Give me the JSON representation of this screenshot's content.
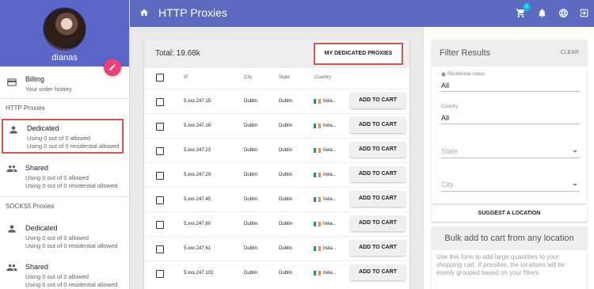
{
  "profile": {
    "username": "dianas"
  },
  "sidebar": {
    "billing": {
      "title": "Billing",
      "subtitle": "Your order history"
    },
    "http_section": "HTTP Proxies",
    "http_items": [
      {
        "title": "Dedicated",
        "line1": "Using 0 out of 0 allowed",
        "line2": "Using 0 out of 0 residential allowed"
      },
      {
        "title": "Shared",
        "line1": "Using 0 out of 0 allowed",
        "line2": "Using 0 out of 0 residential allowed"
      }
    ],
    "socks_section": "SOCKS5 Proxies",
    "socks_items": [
      {
        "title": "Dedicated",
        "line1": "Using 0 out of 0 allowed",
        "line2": "Using 0 out of 0 residential allowed"
      },
      {
        "title": "Shared",
        "line1": "Using 0 out of 0 allowed",
        "line2": "Using 0 out of 0 residential allowed"
      }
    ]
  },
  "topbar": {
    "title": "HTTP Proxies",
    "cart_count": "0"
  },
  "table": {
    "total": "Total: 19.68k",
    "dedicated_button": "MY DEDICATED PROXIES",
    "headers": {
      "ip": "IP",
      "city": "City",
      "state": "State",
      "country": "Country"
    },
    "add_label": "ADD TO CART",
    "rows": [
      {
        "ip": "5.xxx.247.15",
        "city": "Dublin",
        "state": "Dublin",
        "country": "Irela..."
      },
      {
        "ip": "5.xxx.247.18",
        "city": "Dublin",
        "state": "Dublin",
        "country": "Irela..."
      },
      {
        "ip": "5.xxx.247.23",
        "city": "Dublin",
        "state": "Dublin",
        "country": "Irela..."
      },
      {
        "ip": "5.xxx.247.29",
        "city": "Dublin",
        "state": "Dublin",
        "country": "Irela..."
      },
      {
        "ip": "5.xxx.247.45",
        "city": "Dublin",
        "state": "Dublin",
        "country": "Irela..."
      },
      {
        "ip": "5.xxx.247.60",
        "city": "Dublin",
        "state": "Dublin",
        "country": "Irela..."
      },
      {
        "ip": "5.xxx.247.61",
        "city": "Dublin",
        "state": "Dublin",
        "country": "Irela..."
      },
      {
        "ip": "5.xxx.247.102",
        "city": "Dublin",
        "state": "Dublin",
        "country": "Irela..."
      }
    ]
  },
  "filter": {
    "title": "Filter Results",
    "clear": "CLEAR",
    "residential_label": "Residential status",
    "residential_value": "All",
    "country_label": "Country",
    "country_value": "All",
    "state_placeholder": "State",
    "city_placeholder": "City",
    "suggest_button": "SUGGEST A LOCATION"
  },
  "bulk": {
    "title": "Bulk add to cart from any location",
    "text": "Use this form to add large quantities to your shopping cart. If possible, the locations will be evenly grouped based on your filters."
  },
  "colors": {
    "primary": "#5c6bc0",
    "accent": "#ec407a",
    "badge": "#00bcd4",
    "highlight": "#d9534f"
  }
}
